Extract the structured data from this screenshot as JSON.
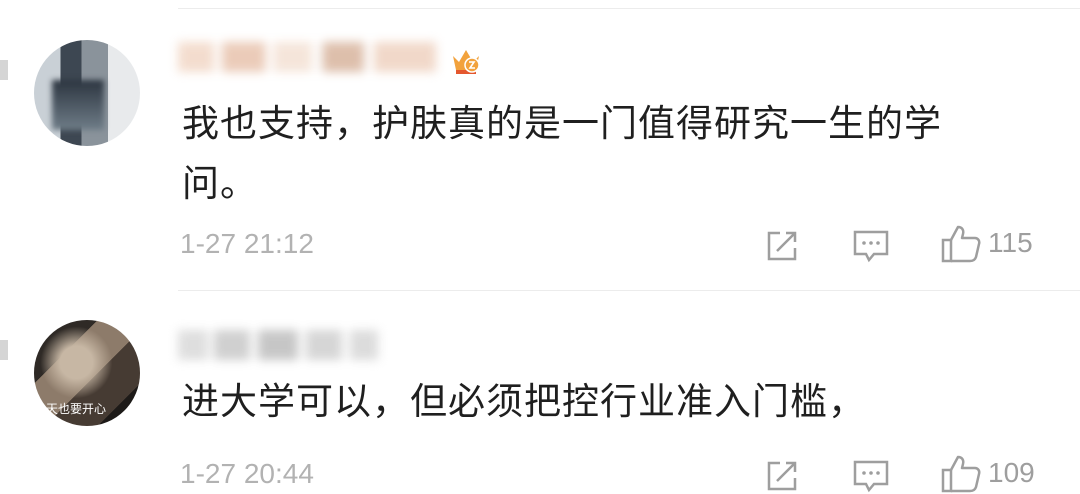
{
  "comments": [
    {
      "text": "我也支持，护肤真的是一门值得研究一生的学问。",
      "timestamp": "1-27 21:12",
      "likes": "115"
    },
    {
      "avatar_caption": "天也要开心",
      "text": "进大学可以，但必须把控行业准入门槛，",
      "timestamp": "1-27 20:44",
      "likes": "109"
    }
  ],
  "icons": {
    "share": "share-icon",
    "reply": "comment-icon",
    "like": "thumbs-up-icon",
    "vip_badge": "vip-crown-badge-icon"
  },
  "colors": {
    "text": "#1f1f1f",
    "meta": "#b2b2b2",
    "icon": "#9e9e9e",
    "badge_orange": "#f2a23c",
    "badge_red": "#e4572e"
  }
}
